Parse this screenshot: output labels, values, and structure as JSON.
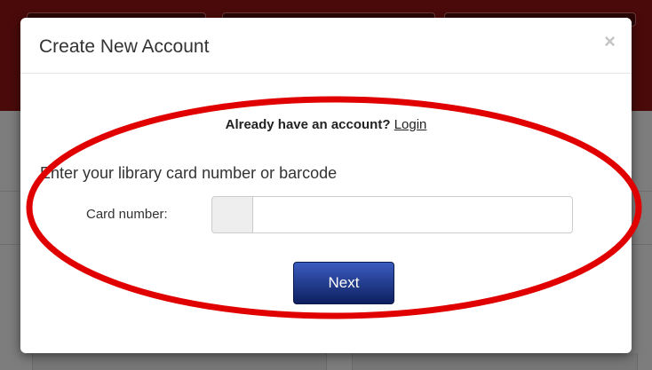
{
  "modal": {
    "title": "Create New Account",
    "close_symbol": "×",
    "already_text": "Already have an account?",
    "login_link": "Login",
    "instructions": "Enter your library card number or barcode",
    "card_label": "Card number:",
    "card_value": "",
    "next_label": "Next"
  },
  "colors": {
    "annotation": "#e00000",
    "button_top": "#3a5cc0",
    "button_bottom": "#0e1f5e",
    "header_bg": "#4a0a0a"
  }
}
